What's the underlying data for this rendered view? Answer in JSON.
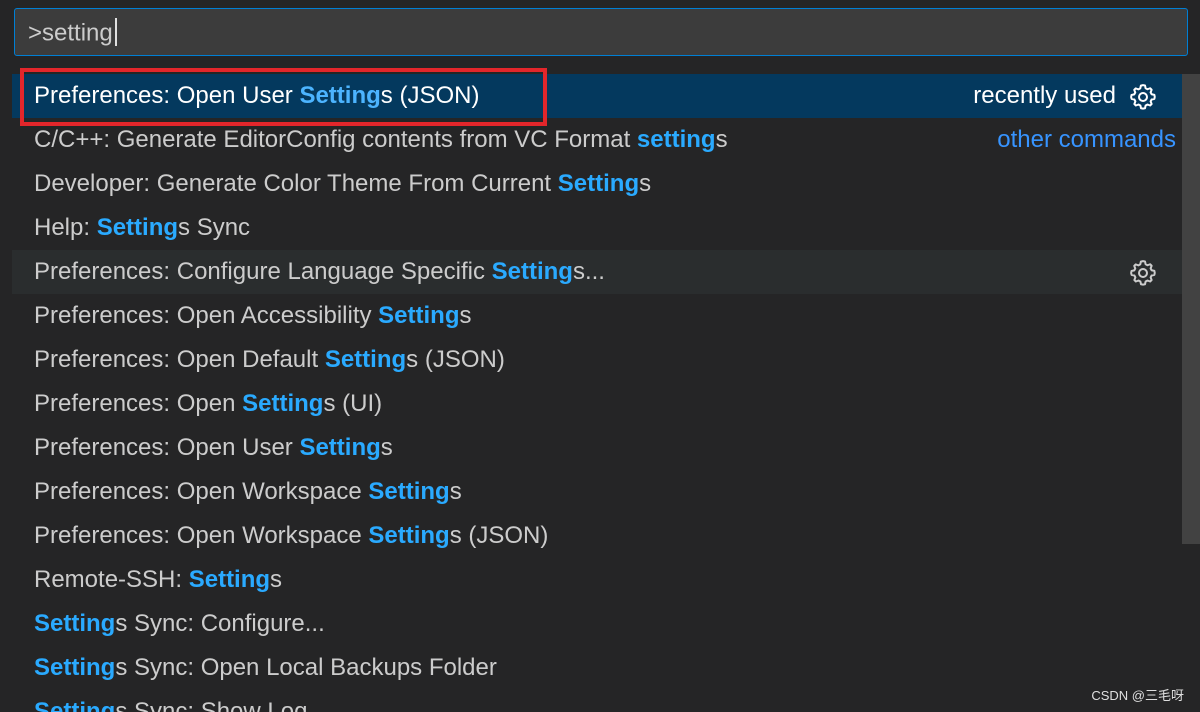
{
  "input": {
    "value": ">setting"
  },
  "rows": [
    {
      "prefix": "Preferences: Open User ",
      "match": "Setting",
      "suffix": "s (JSON)",
      "right": "recently used",
      "gear": true
    },
    {
      "prefix": "C/C++: Generate EditorConfig contents from VC Format ",
      "match": "setting",
      "suffix": "s",
      "right": "other commands",
      "gear": false
    },
    {
      "prefix": "Developer: Generate Color Theme From Current ",
      "match": "Setting",
      "suffix": "s",
      "right": "",
      "gear": false
    },
    {
      "prefix": "Help: ",
      "match": "Setting",
      "suffix": "s Sync",
      "right": "",
      "gear": false
    },
    {
      "prefix": "Preferences: Configure Language Specific ",
      "match": "Setting",
      "suffix": "s...",
      "right": "",
      "gear": true
    },
    {
      "prefix": "Preferences: Open Accessibility ",
      "match": "Setting",
      "suffix": "s",
      "right": "",
      "gear": false
    },
    {
      "prefix": "Preferences: Open Default ",
      "match": "Setting",
      "suffix": "s (JSON)",
      "right": "",
      "gear": false
    },
    {
      "prefix": "Preferences: Open ",
      "match": "Setting",
      "suffix": "s (UI)",
      "right": "",
      "gear": false
    },
    {
      "prefix": "Preferences: Open User ",
      "match": "Setting",
      "suffix": "s",
      "right": "",
      "gear": false
    },
    {
      "prefix": "Preferences: Open Workspace ",
      "match": "Setting",
      "suffix": "s",
      "right": "",
      "gear": false
    },
    {
      "prefix": "Preferences: Open Workspace ",
      "match": "Setting",
      "suffix": "s (JSON)",
      "right": "",
      "gear": false
    },
    {
      "prefix": "Remote-SSH: ",
      "match": "Setting",
      "suffix": "s",
      "right": "",
      "gear": false
    },
    {
      "prefix": "",
      "match": "Setting",
      "suffix": "s Sync: Configure...",
      "right": "",
      "gear": false
    },
    {
      "prefix": "",
      "match": "Setting",
      "suffix": "s Sync: Open Local Backups Folder",
      "right": "",
      "gear": false
    },
    {
      "prefix": "",
      "match": "Setting",
      "suffix": "s Sync: Show Log",
      "right": "",
      "gear": false
    }
  ],
  "watermark": "CSDN @三毛呀",
  "colors": {
    "background": "#252526",
    "selected_row": "#04395e",
    "highlight": "#2aaaff",
    "annotation_box": "#e3262b",
    "other_commands": "#3794ff"
  }
}
